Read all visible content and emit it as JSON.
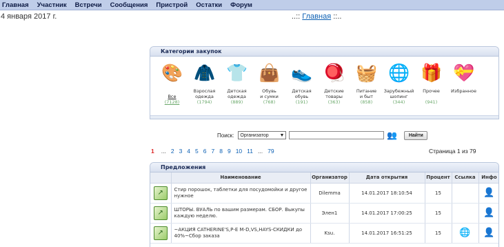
{
  "nav": [
    "Главная",
    "Участник",
    "Встречи",
    "Сообщения",
    "Пристрой",
    "Остатки",
    "Форум"
  ],
  "date": "4 января 2017 г.",
  "breadcrumb": {
    "pre": "..:: ",
    "link": "Главная",
    "post": " ::.."
  },
  "categories": {
    "title": "Категории закупок",
    "items": [
      {
        "l1": "Все",
        "l2": "",
        "count": "(7128)",
        "icon": "palette-icon",
        "glyph": "🎨"
      },
      {
        "l1": "Взрослая",
        "l2": "одежда",
        "count": "(1794)",
        "icon": "jacket-icon",
        "glyph": "🧥"
      },
      {
        "l1": "Детская",
        "l2": "одежда",
        "count": "(889)",
        "icon": "kids-clothes-icon",
        "glyph": "👕"
      },
      {
        "l1": "Обувь",
        "l2": "и сумки",
        "count": "(768)",
        "icon": "handbag-icon",
        "glyph": "👜"
      },
      {
        "l1": "Детская",
        "l2": "обувь",
        "count": "(191)",
        "icon": "baby-shoe-icon",
        "glyph": "👟"
      },
      {
        "l1": "Детские",
        "l2": "товары",
        "count": "(363)",
        "icon": "toy-icon",
        "glyph": "🪀"
      },
      {
        "l1": "Питание",
        "l2": "и быт",
        "count": "(858)",
        "icon": "washing-machine-icon",
        "glyph": "🧺"
      },
      {
        "l1": "Зарубежный",
        "l2": "шопинг",
        "count": "(344)",
        "icon": "globe-icon",
        "glyph": "🌐"
      },
      {
        "l1": "Прочее",
        "l2": "",
        "count": "(941)",
        "icon": "gift-icon",
        "glyph": "🎁"
      },
      {
        "l1": "Избранное",
        "l2": "",
        "count": "",
        "icon": "heart-icon",
        "glyph": "💝"
      }
    ]
  },
  "search": {
    "label": "Поиск:",
    "option": "Организатор",
    "button": "Найти"
  },
  "pagination": {
    "current": "1",
    "items": [
      "...",
      "2",
      "3",
      "4",
      "5",
      "6",
      "7",
      "8",
      "9",
      "10",
      "11",
      "...",
      "79"
    ],
    "info": "Страница 1 из 79"
  },
  "offers": {
    "title": "Предложения",
    "columns": [
      "",
      "Наименование",
      "Организатор",
      "Дата открытия",
      "Процент",
      "Ссылка",
      "Инфо"
    ],
    "rows": [
      {
        "name": "Стир порошок, таблетки для посудомойки и другое нужное",
        "org": "Dilemma",
        "date": "14.01.2017 18:10:54",
        "pct": "15",
        "link": false
      },
      {
        "name": "ШТОРЫ. ВУАЛЬ по вашим размерам. СБОР. Выкупы каждую неделю.",
        "org": "Элен1",
        "date": "14.01.2017 17:00:25",
        "pct": "15",
        "link": false
      },
      {
        "name": "~АКЦИЯ CATHERINE'S,Р-Е M-D,VS,HAYS-СКИДКИ до 40%~Сбор заказа",
        "org": "Ksu.",
        "date": "14.01.2017 16:51:25",
        "pct": "15",
        "link": true
      }
    ]
  }
}
